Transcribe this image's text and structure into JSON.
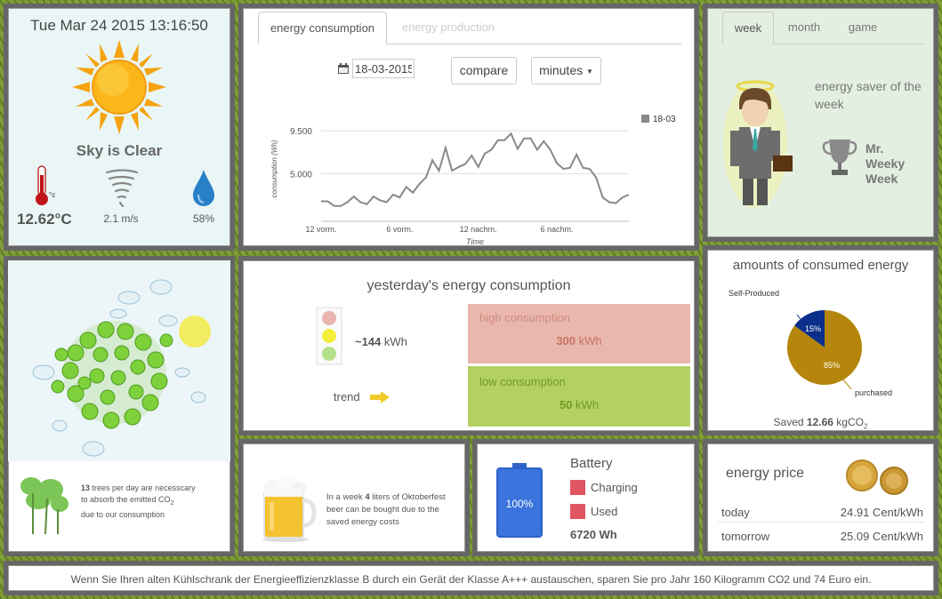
{
  "weather": {
    "datetime": "Tue Mar 24 2015 13:16:50",
    "condition": "Sky is Clear",
    "temperature": "12.62°C",
    "temp_unit": "°c",
    "wind": "2.1 m/s",
    "humidity": "58%"
  },
  "consumption_chart": {
    "tabs": [
      "energy consumption",
      "energy production"
    ],
    "active_tab": 0,
    "date": "18-03-2015",
    "compare_label": "compare",
    "minutes_label": "minutes"
  },
  "chart_data": {
    "type": "line",
    "title": "",
    "xlabel": "Time",
    "ylabel": "consumption (Wh)",
    "yticks": [
      "9.500",
      "5.000"
    ],
    "ytick_values": [
      9500,
      5000
    ],
    "xticks": [
      "12 vorm.",
      "6 vorm.",
      "12 nachm.",
      "6 nachm."
    ],
    "xtick_values": [
      0,
      6,
      12,
      18
    ],
    "xlim": [
      0,
      23.5
    ],
    "ylim": [
      0,
      11000
    ],
    "legend": "top-right",
    "series": [
      {
        "name": "18-03",
        "color": "#888888",
        "x": [
          0,
          0.5,
          1,
          1.5,
          2,
          2.5,
          3,
          3.5,
          4,
          4.5,
          5,
          5.5,
          6,
          6.5,
          7,
          7.5,
          8,
          8.5,
          9,
          9.5,
          10,
          10.5,
          11,
          11.5,
          12,
          12.5,
          13,
          13.5,
          14,
          14.5,
          15,
          15.5,
          16,
          16.5,
          17,
          17.5,
          18,
          18.5,
          19,
          19.5,
          20,
          20.5,
          21,
          21.5,
          22,
          22.5,
          23,
          23.5
        ],
        "values": [
          2100,
          2100,
          1600,
          1600,
          2000,
          2600,
          2000,
          1800,
          2600,
          2200,
          2000,
          2800,
          2500,
          3600,
          3000,
          3900,
          4600,
          6400,
          5300,
          7700,
          5300,
          5700,
          6000,
          6900,
          5700,
          7100,
          7500,
          8500,
          8500,
          9200,
          7600,
          8700,
          8700,
          7500,
          8400,
          7500,
          6100,
          5500,
          5600,
          7000,
          5600,
          5500,
          4600,
          2500,
          2000,
          1900,
          2500,
          2800
        ]
      }
    ]
  },
  "yesterday": {
    "title": "yesterday's energy consumption",
    "kwh_value": "~144",
    "kwh_unit": "kWh",
    "trend_label": "trend",
    "high_label": "high consumption",
    "high_value": "300",
    "high_unit": "kWh",
    "low_label": "low consumption",
    "low_value": "50",
    "low_unit": "kWh"
  },
  "ranking": {
    "tabs": [
      "week",
      "month",
      "game"
    ],
    "active_tab": 0,
    "saver_title": "energy saver of the week",
    "winner": "Mr. Weeky Week"
  },
  "amounts": {
    "title": "amounts of consumed energy",
    "self_label": "Self-Produced",
    "purchased_label": "purchased",
    "self_pct": 15,
    "purchased_pct": 85,
    "self_text": "15%",
    "purchased_text": "85%",
    "self_color": "#0b2f8a",
    "purchased_color": "#b5860b",
    "saved_prefix": "Saved",
    "saved_value": "12.66",
    "saved_unit": "kgCO",
    "saved_sub": "2"
  },
  "trees": {
    "count": "13",
    "line1": "trees per day are necesscary",
    "line2": "to absorb the emitted CO",
    "co2_sub": "2",
    "line3": "due to our consumption"
  },
  "beer": {
    "pre": "In a week",
    "liters": "4",
    "line1_post": "liters of Oktoberfest",
    "line2": "beer can be bought due to the",
    "line3": "saved energy costs"
  },
  "battery": {
    "title": "Battery",
    "level_pct": 100,
    "level_text": "100%",
    "legend_charging": "Charging",
    "legend_used": "Used",
    "energy": "6720 Wh"
  },
  "price": {
    "title": "energy price",
    "today_label": "today",
    "today_value": "24.91 Cent/kWh",
    "tomorrow_label": "tomorrow",
    "tomorrow_value": "25.09 Cent/kWh"
  },
  "ticker": "Wenn Sie Ihren alten Kühlschrank der Energieeffizienzklasse B durch ein Gerät der Klasse A+++ austauschen, sparen Sie pro Jahr 160 Kilogramm CO2 und 74 Euro ein."
}
